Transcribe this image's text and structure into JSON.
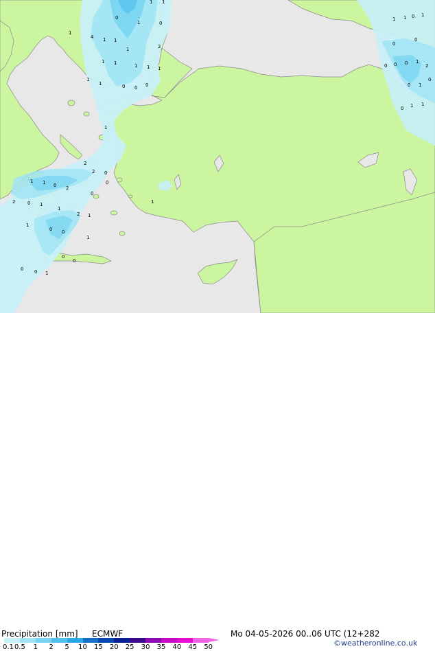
{
  "legend": {
    "title": "Precipitation [mm]",
    "model": "ECMWF",
    "datetime": "Mo 04-05-2026 00..06 UTC (12+282",
    "credit": "©weatheronline.co.uk",
    "ticks": [
      "0.1",
      "0.5",
      "1",
      "2",
      "5",
      "10",
      "15",
      "20",
      "25",
      "30",
      "35",
      "40",
      "45",
      "50"
    ],
    "colors": [
      "#c8f0f8",
      "#a0e4f4",
      "#78d4f0",
      "#50c0ec",
      "#28a8e4",
      "#1470c8",
      "#0a46b4",
      "#0a1e96",
      "#3c0a8c",
      "#8c0ab4",
      "#c80ac8",
      "#e60ad2",
      "#f064e6"
    ]
  },
  "map_colors": {
    "sea": "#e8e8e8",
    "land_dry": "#ccf5a0",
    "land_outside": "#f2f2f2",
    "coast": "#8a8a8a"
  },
  "precip_values": [
    "1",
    "0",
    "1",
    "0",
    "1",
    "1",
    "4",
    "1",
    "1",
    "1",
    "2",
    "1",
    "1",
    "1",
    "1",
    "1",
    "0",
    "0",
    "0",
    "1",
    "1",
    "2",
    "1",
    "1",
    "0",
    "2",
    "2",
    "0",
    "2",
    "0",
    "1",
    "1",
    "2",
    "1",
    "1",
    "0",
    "0",
    "1",
    "0",
    "0",
    "1",
    "0",
    "1",
    "1",
    "0",
    "1",
    "0",
    "0",
    "0",
    "0",
    "0",
    "1",
    "2",
    "0",
    "1",
    "0",
    "0",
    "1",
    "1",
    "1",
    "1",
    "0",
    "0",
    "0"
  ]
}
